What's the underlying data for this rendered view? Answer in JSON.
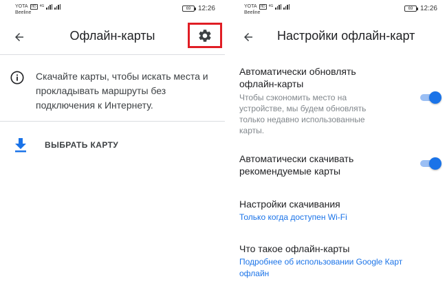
{
  "status": {
    "carrier_top": "YOTA",
    "network_badge": "HD",
    "network_type": "4G",
    "carrier_bottom": "Beeline",
    "battery": "69",
    "time": "12:26"
  },
  "left_screen": {
    "title": "Офлайн-карты",
    "info_text": "Скачайте карты, чтобы искать места и прокладывать маршруты без подключения к Интернету.",
    "select_map_label": "ВЫБРАТЬ КАРТУ",
    "icons": [
      "back-arrow-icon",
      "gear-icon",
      "info-icon",
      "download-icon"
    ],
    "highlight_color": "#e01d24"
  },
  "right_screen": {
    "title": "Настройки офлайн-карт",
    "auto_update": {
      "title": "Автоматически обновлять офлайн-карты",
      "description": "Чтобы сэкономить место на устройстве, мы будем обновлять только недавно использованные карты.",
      "enabled": true
    },
    "auto_download": {
      "title": "Автоматически скачивать рекомендуемые карты",
      "enabled": true
    },
    "download_settings": {
      "title": "Настройки скачивания",
      "value": "Только когда доступен Wi-Fi"
    },
    "what_is": {
      "title": "Что такое офлайн-карты",
      "link": "Подробнее об использовании Google Карт офлайн"
    }
  },
  "colors": {
    "accent": "#1a73e8",
    "toggle_track": "#9bbff4",
    "text_primary": "#202124",
    "text_secondary": "#80868b",
    "divider": "#dadce0"
  }
}
